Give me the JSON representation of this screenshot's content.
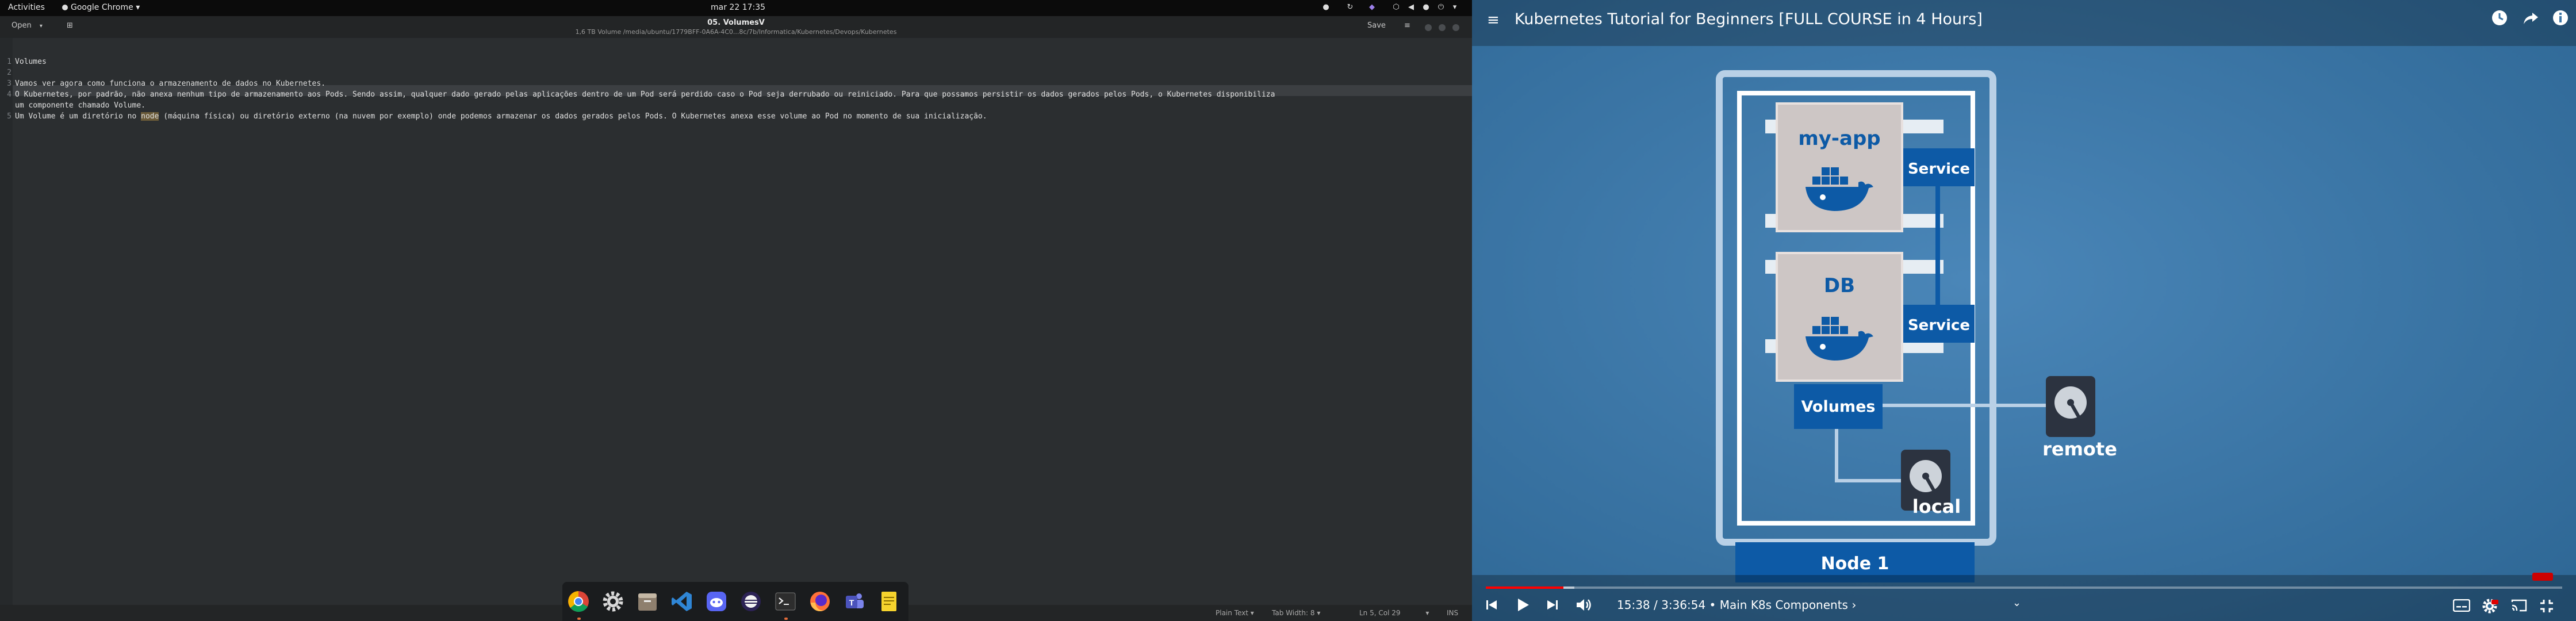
{
  "topbar": {
    "activities": "Activities",
    "app_menu": "Google Chrome",
    "clock": "mar 22  17:35"
  },
  "editor": {
    "open_label": "Open",
    "save_label": "Save",
    "title": "05. VolumesV",
    "path": "1,6 TB Volume /media/ubuntu/1779BFF-0A6A-4C0...8c/7b/Informatica/Kubernetes/Devops/Kubernetes",
    "line_numbers": [
      "1",
      "2",
      "3",
      "4",
      "",
      "5"
    ],
    "lines": [
      "Volumes",
      "",
      "Vamos ver agora como funciona o armazenamento de dados no Kubernetes.",
      "O Kubernetes, por padrão, não anexa nenhum tipo de armazenamento aos Pods. Sendo assim, qualquer dado gerado pelas aplicações dentro de um Pod será perdido caso o Pod seja derrubado ou reiniciado. Para que possamos persistir os dados gerados pelos Pods, o Kubernetes disponibiliza",
      "um componente chamado Volume."
    ],
    "line5": {
      "before": "Um Volume é um diretório no ",
      "selected": "node",
      "after": " (máquina física) ou diretório externo (na nuvem por exemplo) onde podemos armazenar os dados gerados pelos Pods. O Kubernetes anexa esse volume ao Pod no momento de sua inicialização."
    },
    "status": {
      "language": "Plain Text",
      "tab_width": "Tab Width: 8",
      "cursor": "Ln 5, Col 29",
      "mode": "INS"
    }
  },
  "dock": {
    "apps": [
      "chrome-icon",
      "settings-icon",
      "files-icon",
      "vscode-icon",
      "discord-icon",
      "eclipse-icon",
      "terminal-icon",
      "firefox-icon",
      "teams-icon",
      "notes-icon"
    ]
  },
  "video": {
    "title": "Kubernetes Tutorial for Beginners [FULL COURSE in 4 Hours]",
    "time": "15:38 / 3:36:54",
    "chapter": "Main K8s Components",
    "progress_fraction": 0.072,
    "buffered_fraction": 0.082,
    "slide": {
      "app_label": "my-app",
      "db_label": "DB",
      "service1": "Service",
      "service2": "Service",
      "volumes": "Volumes",
      "remote": "remote",
      "local": "local",
      "node": "Node 1"
    },
    "colors": {
      "slide_bg": "#3a74a5",
      "box_blue": "#0d5aa6",
      "pod_gray": "#cdc6c5",
      "progress_red": "#ff0000"
    }
  }
}
